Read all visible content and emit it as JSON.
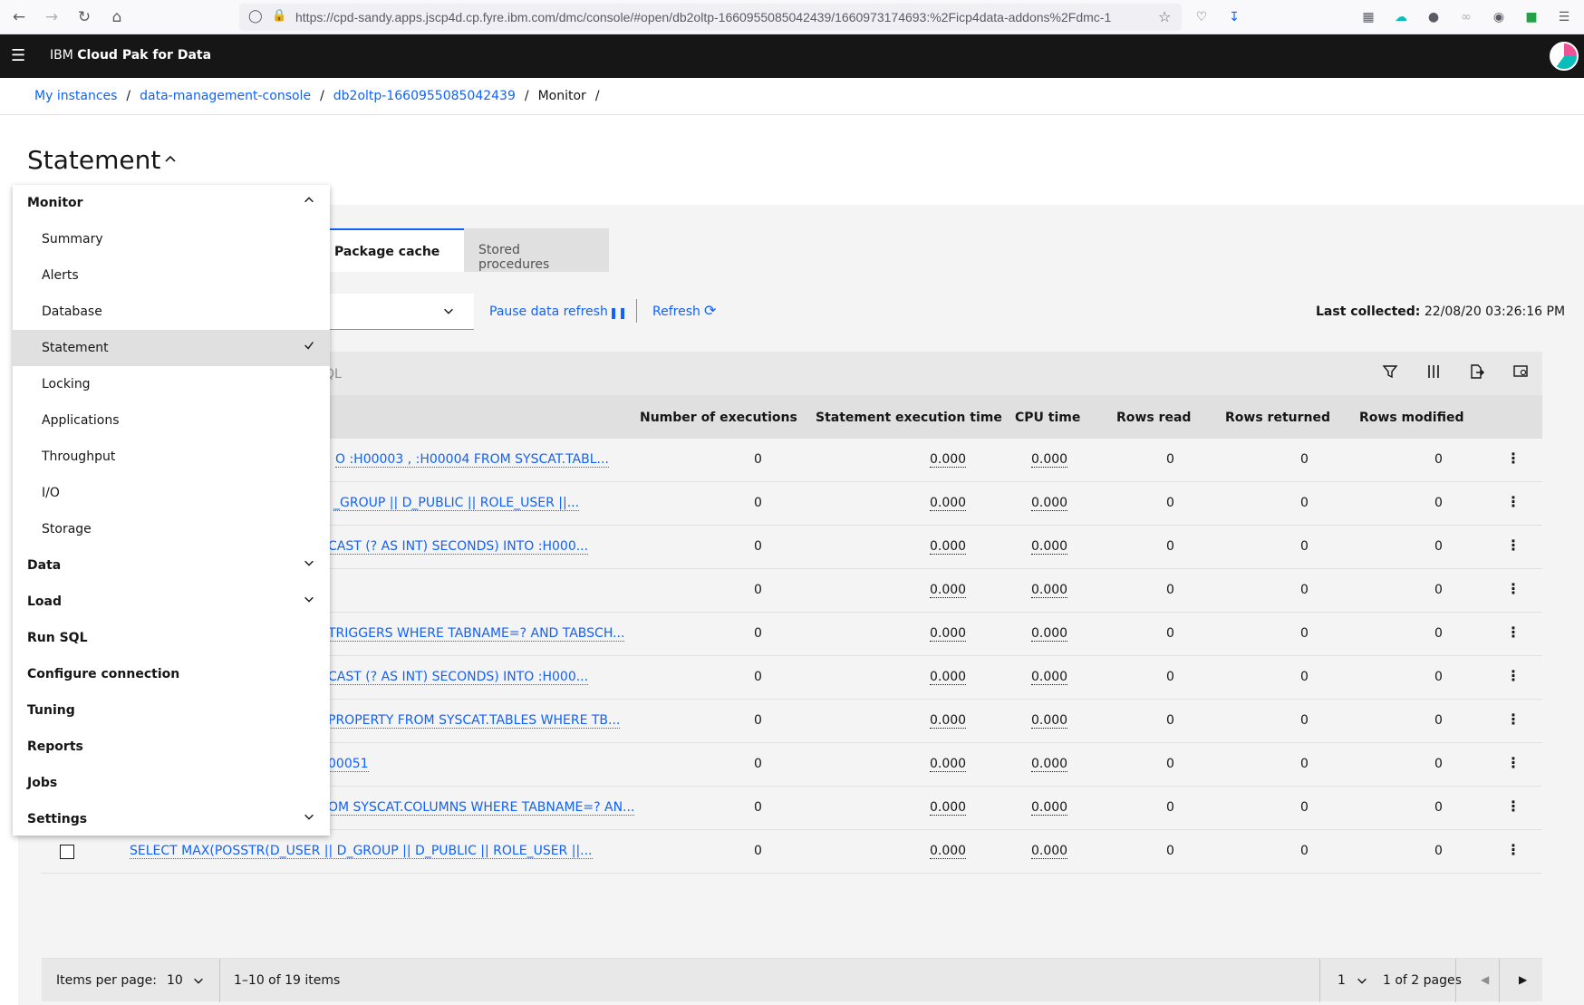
{
  "browser": {
    "url": "https://cpd-sandy.apps.jscp4d.cp.fyre.ibm.com/dmc/console/#open/db2oltp-1660955085042439/1660973174693:%2Ficp4data-addons%2Fdmc-1"
  },
  "header": {
    "brand_prefix": "IBM",
    "brand_name": "Cloud Pak for Data"
  },
  "breadcrumb": {
    "items": [
      "My instances",
      "data-management-console",
      "db2oltp-1660955085042439",
      "Monitor"
    ],
    "separator": "/"
  },
  "page": {
    "title": "Statement"
  },
  "tabs": [
    {
      "label": "Package cache",
      "active": true
    },
    {
      "label": "Stored procedures",
      "active": false
    }
  ],
  "toolbar": {
    "pause_label": "Pause data refresh",
    "refresh_label": "Refresh",
    "last_collected_label": "Last collected:",
    "last_collected_value": "22/08/20 03:26:16 PM"
  },
  "table": {
    "search_partial": "QL",
    "columns": [
      "Number of executions",
      "Statement execution time",
      "CPU time",
      "Rows read",
      "Rows returned",
      "Rows modified"
    ],
    "rows": [
      {
        "stmt": "O :H00003 , :H00004 FROM SYSCAT.TABL...",
        "exec": "0",
        "time": "0.000",
        "cpu": "0.000",
        "read": "0",
        "returned": "0",
        "modified": "0"
      },
      {
        "stmt": "_GROUP || D_PUBLIC || ROLE_USER ||...",
        "exec": "0",
        "time": "0.000",
        "cpu": "0.000",
        "read": "0",
        "returned": "0",
        "modified": "0"
      },
      {
        "stmt": "CAST (? AS INT) SECONDS) INTO :H000...",
        "exec": "0",
        "time": "0.000",
        "cpu": "0.000",
        "read": "0",
        "returned": "0",
        "modified": "0"
      },
      {
        "stmt": "",
        "exec": "0",
        "time": "0.000",
        "cpu": "0.000",
        "read": "0",
        "returned": "0",
        "modified": "0"
      },
      {
        "stmt": "TRIGGERS WHERE TABNAME=? AND TABSCH...",
        "exec": "0",
        "time": "0.000",
        "cpu": "0.000",
        "read": "0",
        "returned": "0",
        "modified": "0"
      },
      {
        "stmt": "CAST (? AS INT) SECONDS) INTO :H000...",
        "exec": "0",
        "time": "0.000",
        "cpu": "0.000",
        "read": "0",
        "returned": "0",
        "modified": "0"
      },
      {
        "stmt": "PROPERTY FROM SYSCAT.TABLES WHERE TB...",
        "exec": "0",
        "time": "0.000",
        "cpu": "0.000",
        "read": "0",
        "returned": "0",
        "modified": "0"
      },
      {
        "stmt": "00051",
        "exec": "0",
        "time": "0.000",
        "cpu": "0.000",
        "read": "0",
        "returned": "0",
        "modified": "0"
      },
      {
        "stmt": "OM SYSCAT.COLUMNS WHERE TABNAME=? AN...",
        "exec": "0",
        "time": "0.000",
        "cpu": "0.000",
        "read": "0",
        "returned": "0",
        "modified": "0"
      },
      {
        "stmt": "SELECT MAX(POSSTR(D_USER || D_GROUP || D_PUBLIC || ROLE_USER ||...",
        "exec": "0",
        "time": "0.000",
        "cpu": "0.000",
        "read": "0",
        "returned": "0",
        "modified": "0"
      }
    ]
  },
  "pagination": {
    "items_per_page_label": "Items per page:",
    "items_per_page": "10",
    "range": "1–10 of 19 items",
    "page": "1",
    "of_pages": "1 of 2 pages"
  },
  "menu": {
    "items": [
      {
        "label": "Monitor",
        "level": "top",
        "chevron": "up"
      },
      {
        "label": "Summary",
        "level": "sub"
      },
      {
        "label": "Alerts",
        "level": "sub"
      },
      {
        "label": "Database",
        "level": "sub"
      },
      {
        "label": "Statement",
        "level": "sub",
        "selected": true
      },
      {
        "label": "Locking",
        "level": "sub"
      },
      {
        "label": "Applications",
        "level": "sub"
      },
      {
        "label": "Throughput",
        "level": "sub"
      },
      {
        "label": "I/O",
        "level": "sub"
      },
      {
        "label": "Storage",
        "level": "sub"
      },
      {
        "label": "Data",
        "level": "top",
        "chevron": "down"
      },
      {
        "label": "Load",
        "level": "top",
        "chevron": "down"
      },
      {
        "label": "Run SQL",
        "level": "top"
      },
      {
        "label": "Configure connection",
        "level": "top"
      },
      {
        "label": "Tuning",
        "level": "top"
      },
      {
        "label": "Reports",
        "level": "top"
      },
      {
        "label": "Jobs",
        "level": "top"
      },
      {
        "label": "Settings",
        "level": "top",
        "chevron": "down"
      }
    ]
  },
  "colors": {
    "accent": "#0f62fe",
    "header_bg": "#161616",
    "content_bg": "#f4f4f4"
  }
}
